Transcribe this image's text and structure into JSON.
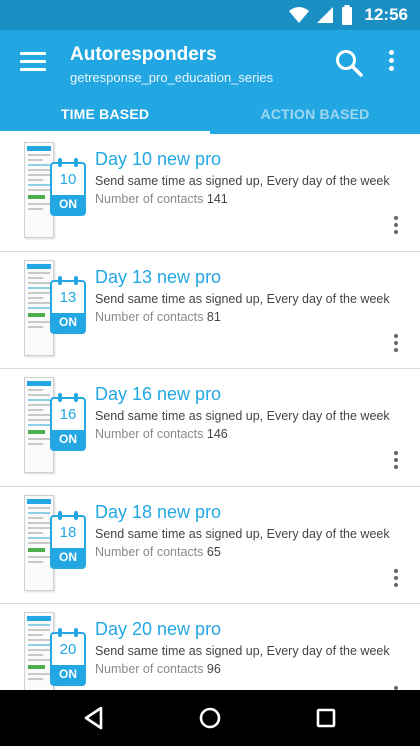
{
  "status_bar": {
    "time": "12:56",
    "icons": [
      "wifi-icon",
      "signal-icon",
      "battery-icon"
    ]
  },
  "app_bar": {
    "title": "Autoresponders",
    "subtitle": "getresponse_pro_education_series",
    "icons": [
      "menu-icon",
      "search-icon",
      "overflow-menu-icon"
    ],
    "color": "#22a7e3"
  },
  "tabs": [
    {
      "label": "TIME BASED",
      "active": true
    },
    {
      "label": "ACTION BASED",
      "active": false
    }
  ],
  "autoresponders": [
    {
      "day": "10",
      "status": "ON",
      "title": "Day 10 new pro",
      "description": "Send same time as signed up, Every day of the week",
      "contacts_label": "Number of contacts",
      "contacts": "141"
    },
    {
      "day": "13",
      "status": "ON",
      "title": "Day 13 new pro",
      "description": "Send same time as signed up, Every day of the week",
      "contacts_label": "Number of contacts",
      "contacts": "81"
    },
    {
      "day": "16",
      "status": "ON",
      "title": "Day 16 new pro",
      "description": "Send same time as signed up, Every day of the week",
      "contacts_label": "Number of contacts",
      "contacts": "146"
    },
    {
      "day": "18",
      "status": "ON",
      "title": "Day 18 new pro",
      "description": "Send same time as signed up, Every day of the week",
      "contacts_label": "Number of contacts",
      "contacts": "65"
    },
    {
      "day": "20",
      "status": "ON",
      "title": "Day 20 new pro",
      "description": "Send same time as signed up, Every day of the week",
      "contacts_label": "Number of contacts",
      "contacts": "96"
    }
  ],
  "nav_bar": {
    "icons": [
      "back-icon",
      "home-icon",
      "recents-icon"
    ]
  }
}
